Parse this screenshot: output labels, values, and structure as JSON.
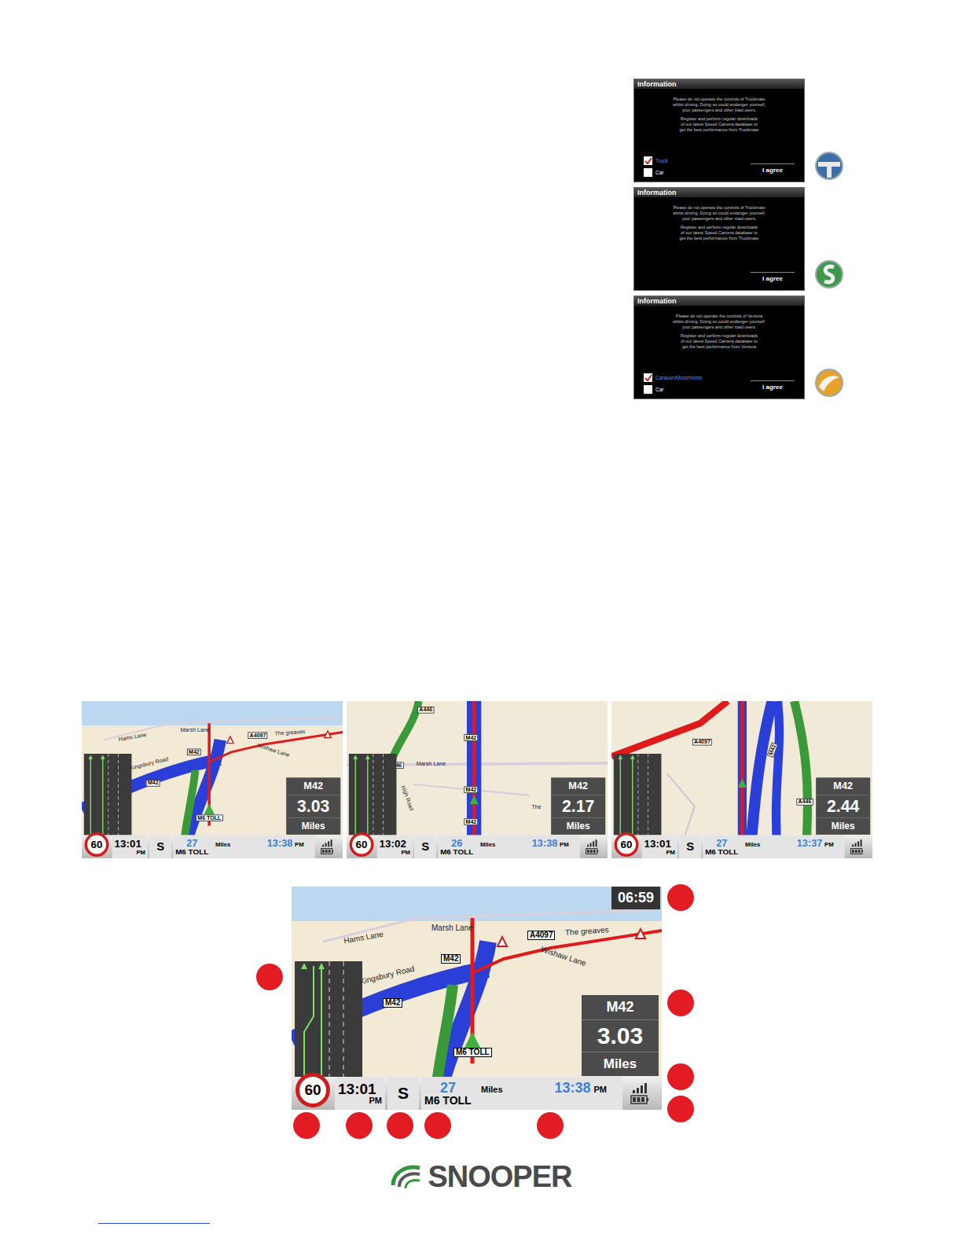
{
  "dialogs": [
    {
      "title": "Information",
      "body": [
        "Please do not operate the controls of Truckmate",
        "whilst driving. Doing so could endanger yourself,",
        "your passengers and other road users.",
        "",
        "Register and perform regular downloads",
        "of our latest Speed Camera database to",
        "get the best performance from Truckmate"
      ],
      "options": [
        {
          "label": "Truck",
          "checked": true
        },
        {
          "label": "Car",
          "checked": false
        }
      ],
      "button": "I agree"
    },
    {
      "title": "Information",
      "body": [
        "Please do not operate the controls of Truckmate",
        "whilst driving. Doing so could endanger yourself,",
        "your passengers and other road users.",
        "",
        "Register and perform regular downloads",
        "of our latest Speed Camera database to",
        "get the best performance from Truckmate"
      ],
      "options": [],
      "button": "I agree"
    },
    {
      "title": "Information",
      "body": [
        "Please do not operate the controls of Ventura",
        "whilst driving. Doing so could endanger yourself,",
        "your passengers and other road users.",
        "",
        "Register and perform regular downloads",
        "of our latest Speed Camera database to",
        "get the best performance from Ventura"
      ],
      "options": [
        {
          "label": "Caravan/Motorhome",
          "checked": true
        },
        {
          "label": "Car",
          "checked": false
        }
      ],
      "button": "I agree"
    }
  ],
  "maps": [
    {
      "kind": "3d",
      "labels": [
        {
          "text": "Hams Lane",
          "kind": "street"
        },
        {
          "text": "Marsh Lane",
          "kind": "street"
        },
        {
          "text": "A4097",
          "kind": "shield"
        },
        {
          "text": "The greaves",
          "kind": "street"
        },
        {
          "text": "Wishaw Lane",
          "kind": "street"
        },
        {
          "text": "Kingsbury Road",
          "kind": "street"
        },
        {
          "text": "M42",
          "kind": "shield"
        },
        {
          "text": "M42",
          "kind": "shield"
        },
        {
          "text": "M6 TOLL",
          "kind": "shield"
        }
      ],
      "road": "M42",
      "distance": "3.03",
      "unit": "Miles",
      "speed_limit": "60",
      "time": "13:01",
      "time_suffix": "PM",
      "heading": "S",
      "remaining": "27",
      "remaining_unit": "Miles",
      "eta": "13:38",
      "eta_suffix": "PM",
      "current_road": "M6 TOLL",
      "clock": ""
    },
    {
      "kind": "2d",
      "labels": [
        {
          "text": "A446",
          "kind": "shield"
        },
        {
          "text": "M42",
          "kind": "shield"
        },
        {
          "text": "446",
          "kind": "shield"
        },
        {
          "text": "Marsh Lane",
          "kind": "street"
        },
        {
          "text": "High Road",
          "kind": "street"
        },
        {
          "text": "M42",
          "kind": "shield"
        },
        {
          "text": "M42",
          "kind": "shield"
        },
        {
          "text": "The",
          "kind": "street"
        }
      ],
      "road": "M42",
      "distance": "2.17",
      "unit": "Miles",
      "speed_limit": "60",
      "time": "13:02",
      "time_suffix": "PM",
      "heading": "S",
      "remaining": "26",
      "remaining_unit": "Miles",
      "eta": "13:38",
      "eta_suffix": "PM",
      "current_road": "M6 TOLL",
      "clock": ""
    },
    {
      "kind": "2d",
      "labels": [
        {
          "text": "A4097",
          "kind": "shield"
        },
        {
          "text": "M42",
          "kind": "shield"
        },
        {
          "text": "A446",
          "kind": "shield"
        }
      ],
      "road": "M42",
      "distance": "2.44",
      "unit": "Miles",
      "speed_limit": "60",
      "time": "13:01",
      "time_suffix": "PM",
      "heading": "S",
      "remaining": "27",
      "remaining_unit": "Miles",
      "eta": "13:37",
      "eta_suffix": "PM",
      "current_road": "M6 TOLL",
      "clock": ""
    },
    {
      "kind": "3d",
      "labels": [
        {
          "text": "Hams Lane",
          "kind": "street"
        },
        {
          "text": "Marsh Lane",
          "kind": "street"
        },
        {
          "text": "A4097",
          "kind": "shield"
        },
        {
          "text": "The greaves",
          "kind": "street"
        },
        {
          "text": "Wishaw Lane",
          "kind": "street"
        },
        {
          "text": "Kingsbury Road",
          "kind": "street"
        },
        {
          "text": "M42",
          "kind": "shield"
        },
        {
          "text": "M42",
          "kind": "shield"
        },
        {
          "text": "M6 TOLL",
          "kind": "shield"
        }
      ],
      "road": "M42",
      "distance": "3.03",
      "unit": "Miles",
      "speed_limit": "60",
      "time": "13:01",
      "time_suffix": "PM",
      "heading": "S",
      "remaining": "27",
      "remaining_unit": "Miles",
      "eta": "13:38",
      "eta_suffix": "PM",
      "current_road": "M6 TOLL",
      "clock": "06:59"
    }
  ],
  "logo": "SNOOPER"
}
